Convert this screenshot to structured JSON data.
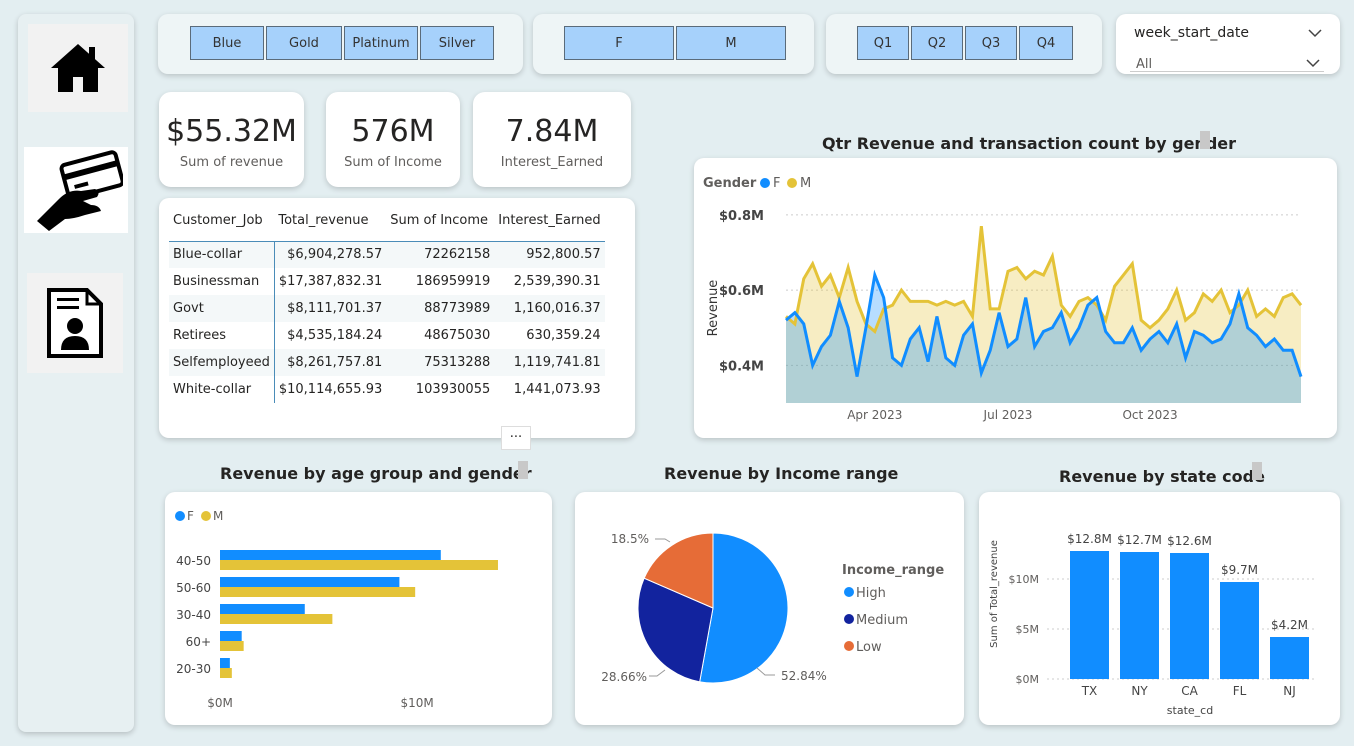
{
  "nav": {
    "items": [
      {
        "name": "home-icon"
      },
      {
        "name": "credit-card-payment-icon"
      },
      {
        "name": "customer-profile-icon"
      }
    ]
  },
  "slicers": {
    "card_category": [
      "Blue",
      "Gold",
      "Platinum",
      "Silver"
    ],
    "gender": [
      "F",
      "M"
    ],
    "quarter": [
      "Q1",
      "Q2",
      "Q3",
      "Q4"
    ],
    "week": {
      "label": "week_start_date",
      "value": "All"
    }
  },
  "kpis": [
    {
      "value": "$55.32M",
      "label": "Sum of revenue"
    },
    {
      "value": "576M",
      "label": "Sum of Income"
    },
    {
      "value": "7.84M",
      "label": "Interest_Earned"
    }
  ],
  "table": {
    "headers": [
      "Customer_Job",
      "Total_revenue",
      "Sum of Income",
      "Interest_Earned"
    ],
    "rows": [
      [
        "Blue-collar",
        "$6,904,278.57",
        "72262158",
        "952,800.57"
      ],
      [
        "Businessman",
        "$17,387,832.31",
        "186959919",
        "2,539,390.31"
      ],
      [
        "Govt",
        "$8,111,701.37",
        "88773989",
        "1,160,016.37"
      ],
      [
        "Retirees",
        "$4,535,184.24",
        "48675030",
        "630,359.24"
      ],
      [
        "Selfemployeed",
        "$8,261,757.81",
        "75313288",
        "1,119,741.81"
      ],
      [
        "White-collar",
        "$10,114,655.93",
        "103930055",
        "1,441,073.93"
      ]
    ],
    "more_label": "···"
  },
  "colors": {
    "F": "#118dff",
    "M": "#e4c338",
    "high": "#118dff",
    "medium": "#12239e",
    "low": "#e66c37"
  },
  "line_title": "Qtr Revenue and transaction count by gender",
  "age_title": "Revenue by age group and gender",
  "pie_title": "Revenue by Income range",
  "state_title": "Revenue by state code",
  "chart_data": [
    {
      "type": "area",
      "title": "Qtr Revenue and transaction count by gender",
      "legend_title": "Gender",
      "ylabel": "Revenue",
      "yticks": [
        "$0.4M",
        "$0.6M",
        "$0.8M"
      ],
      "ylim": [
        0.3,
        0.85
      ],
      "xticks": [
        "Apr 2023",
        "Jul 2023",
        "Oct 2023"
      ],
      "series": [
        {
          "name": "F",
          "values": [
            0.52,
            0.54,
            0.51,
            0.4,
            0.45,
            0.48,
            0.57,
            0.5,
            0.37,
            0.5,
            0.64,
            0.58,
            0.42,
            0.4,
            0.47,
            0.5,
            0.41,
            0.53,
            0.42,
            0.4,
            0.48,
            0.51,
            0.38,
            0.44,
            0.54,
            0.45,
            0.47,
            0.58,
            0.45,
            0.49,
            0.5,
            0.54,
            0.46,
            0.5,
            0.56,
            0.58,
            0.49,
            0.46,
            0.46,
            0.5,
            0.44,
            0.47,
            0.49,
            0.46,
            0.51,
            0.42,
            0.49,
            0.48,
            0.46,
            0.47,
            0.51,
            0.59,
            0.5,
            0.48,
            0.45,
            0.47,
            0.44,
            0.44,
            0.37
          ]
        },
        {
          "name": "M",
          "values": [
            0.53,
            0.51,
            0.63,
            0.67,
            0.61,
            0.64,
            0.58,
            0.66,
            0.57,
            0.51,
            0.49,
            0.55,
            0.56,
            0.6,
            0.57,
            0.57,
            0.57,
            0.56,
            0.57,
            0.56,
            0.57,
            0.53,
            0.77,
            0.55,
            0.55,
            0.65,
            0.66,
            0.63,
            0.65,
            0.64,
            0.69,
            0.56,
            0.53,
            0.57,
            0.58,
            0.56,
            0.52,
            0.61,
            0.64,
            0.67,
            0.52,
            0.5,
            0.52,
            0.55,
            0.6,
            0.52,
            0.54,
            0.59,
            0.57,
            0.6,
            0.54,
            0.56,
            0.6,
            0.53,
            0.55,
            0.53,
            0.58,
            0.59,
            0.56
          ]
        }
      ]
    },
    {
      "type": "bar",
      "orientation": "horizontal",
      "title": "Revenue by age group and gender",
      "categories": [
        "40-50",
        "50-60",
        "30-40",
        "60+",
        "20-30"
      ],
      "xticks": [
        "$0M",
        "$10M"
      ],
      "xlim": [
        0,
        14
      ],
      "series": [
        {
          "name": "F",
          "values": [
            11.2,
            9.1,
            4.3,
            1.1,
            0.5
          ]
        },
        {
          "name": "M",
          "values": [
            14.1,
            9.9,
            5.7,
            1.2,
            0.6
          ]
        }
      ]
    },
    {
      "type": "pie",
      "title": "Revenue by Income range",
      "legend_title": "Income_range",
      "categories": [
        "High",
        "Medium",
        "Low"
      ],
      "values": [
        52.84,
        28.66,
        18.5
      ],
      "labels": [
        "52.84%",
        "28.66%",
        "18.5%"
      ]
    },
    {
      "type": "bar",
      "title": "Revenue by state code",
      "xlabel": "state_cd",
      "ylabel": "Sum of Total_revenue",
      "categories": [
        "TX",
        "NY",
        "CA",
        "FL",
        "NJ"
      ],
      "values": [
        12.8,
        12.7,
        12.6,
        9.7,
        4.2
      ],
      "labels": [
        "$12.8M",
        "$12.7M",
        "$12.6M",
        "$9.7M",
        "$4.2M"
      ],
      "yticks": [
        "$0M",
        "$5M",
        "$10M"
      ],
      "ylim": [
        0,
        14.5
      ]
    }
  ]
}
